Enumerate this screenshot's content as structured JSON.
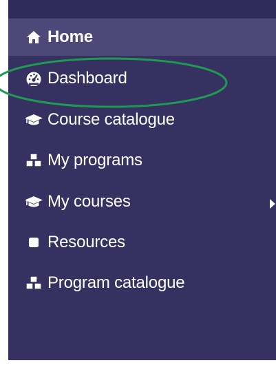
{
  "sidebar": {
    "items": [
      {
        "label": "Home",
        "icon": "home-icon",
        "active": true
      },
      {
        "label": "Dashboard",
        "icon": "dashboard-gauge-icon",
        "active": false
      },
      {
        "label": "Course catalogue",
        "icon": "graduation-cap-icon",
        "active": false
      },
      {
        "label": "My programs",
        "icon": "cubes-icon",
        "active": false
      },
      {
        "label": "My courses",
        "icon": "graduation-cap-icon",
        "active": false
      },
      {
        "label": "Resources",
        "icon": "square-icon",
        "active": false
      },
      {
        "label": "Program catalogue",
        "icon": "cubes-icon",
        "active": false
      }
    ]
  },
  "colors": {
    "sidebar_bg": "#363160",
    "active_bg": "#4d4878",
    "text": "#ffffff",
    "highlight_ellipse": "#1f9a52"
  }
}
